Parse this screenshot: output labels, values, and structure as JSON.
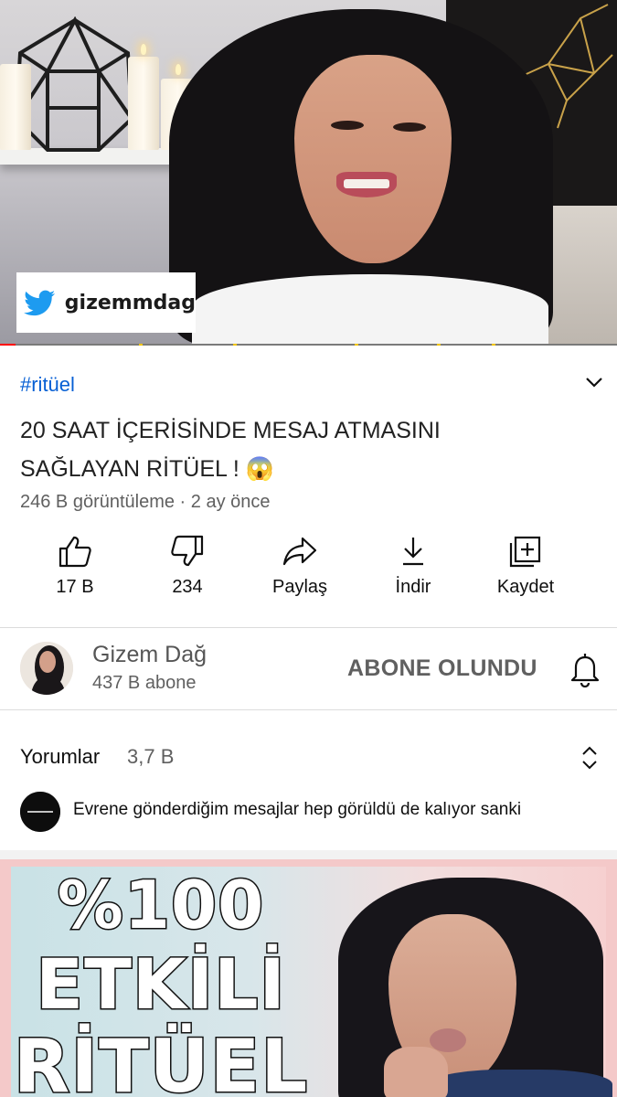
{
  "player": {
    "overlay_handle": "gizemmdag",
    "progress_fraction": 0.025,
    "colors": {
      "progress": "#ff0000",
      "chapter_markers": "#f0c400"
    }
  },
  "video": {
    "hashtag": "#ritüel",
    "title": "20 SAAT İÇERİSİNDE MESAJ ATMASINI SAĞLAYAN RİTÜEL ! 😱",
    "meta": "246 B görüntüleme · 2 ay önce"
  },
  "actions": [
    {
      "label": "17 B",
      "icon": "thumb-up-icon"
    },
    {
      "label": "234",
      "icon": "thumb-down-icon"
    },
    {
      "label": "Paylaş",
      "icon": "share-icon"
    },
    {
      "label": "İndir",
      "icon": "download-icon"
    },
    {
      "label": "Kaydet",
      "icon": "save-playlist-icon"
    }
  ],
  "channel": {
    "name": "Gizem Dağ",
    "subscribers": "437 B abone",
    "subscribe_label": "ABONE OLUNDU"
  },
  "comments": {
    "label": "Yorumlar",
    "count": "3,7 B",
    "preview": "Evrene gönderdiğim mesajlar hep görüldü de kalıyor sanki"
  },
  "next_thumbnail": {
    "lines": [
      "%100",
      "ETKİLİ",
      "RİTÜEL"
    ]
  }
}
